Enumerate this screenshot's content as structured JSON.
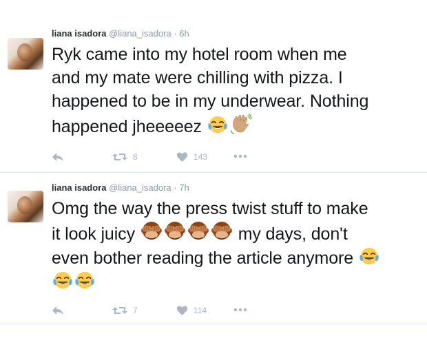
{
  "colors": {
    "text": "#14171a",
    "muted": "#8899a6",
    "action": "#aab8c2",
    "divider": "#e1e8ed"
  },
  "tweets": [
    {
      "name": "liana isadora",
      "handle": "@liana_isadora",
      "dot": "·",
      "time": "6h",
      "text_lines": [
        "Ryk came into my hotel room when me",
        "and my mate were chilling with pizza. I",
        "happened to be in my underwear. Nothing",
        "happened jheeeeez"
      ],
      "emojis": [
        "face-with-tears-of-joy-emoji",
        "waving-hand-emoji"
      ],
      "retweets": "8",
      "likes": "143",
      "icons": [
        "reply-icon",
        "retweet-icon",
        "like-icon",
        "more-icon"
      ]
    },
    {
      "name": "liana isadora",
      "handle": "@liana_isadora",
      "dot": "·",
      "time": "7h",
      "text_parts": {
        "line1": "Omg the way the press twist stuff to make",
        "line2_a": "it look juicy",
        "line2_b": "my days, don't",
        "line3": "even bother reading the article anymore"
      },
      "emojis": [
        "see-no-evil-monkey-emoji",
        "see-no-evil-monkey-emoji",
        "see-no-evil-monkey-emoji",
        "see-no-evil-monkey-emoji",
        "face-with-tears-of-joy-emoji",
        "face-with-tears-of-joy-emoji",
        "face-with-tears-of-joy-emoji"
      ],
      "retweets": "7",
      "likes": "114",
      "icons": [
        "reply-icon",
        "retweet-icon",
        "like-icon",
        "more-icon"
      ]
    }
  ]
}
